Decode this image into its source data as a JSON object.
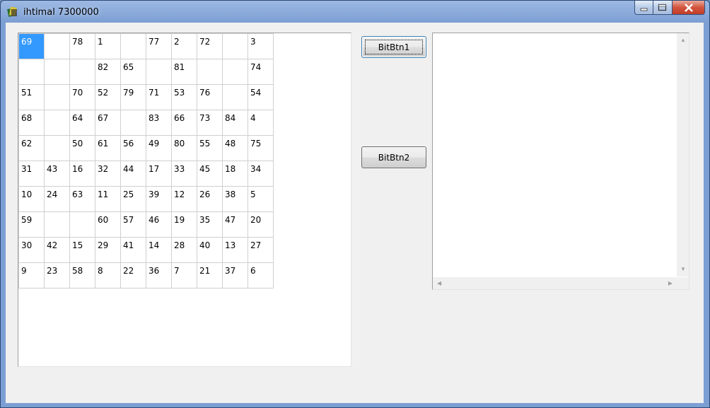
{
  "window": {
    "title": "ihtimal 7300000"
  },
  "grid": {
    "selected": {
      "row": 0,
      "col": 0
    },
    "rows": [
      [
        "69",
        "",
        "78",
        "1",
        "",
        "77",
        "2",
        "72",
        "",
        "3"
      ],
      [
        "",
        "",
        "",
        "82",
        "65",
        "",
        "81",
        "",
        "",
        "74"
      ],
      [
        "51",
        "",
        "70",
        "52",
        "79",
        "71",
        "53",
        "76",
        "",
        "54"
      ],
      [
        "68",
        "",
        "64",
        "67",
        "",
        "83",
        "66",
        "73",
        "84",
        "4"
      ],
      [
        "62",
        "",
        "50",
        "61",
        "56",
        "49",
        "80",
        "55",
        "48",
        "75"
      ],
      [
        "31",
        "43",
        "16",
        "32",
        "44",
        "17",
        "33",
        "45",
        "18",
        "34"
      ],
      [
        "10",
        "24",
        "63",
        "11",
        "25",
        "39",
        "12",
        "26",
        "38",
        "5"
      ],
      [
        "59",
        "",
        "",
        "60",
        "57",
        "46",
        "19",
        "35",
        "47",
        "20"
      ],
      [
        "30",
        "42",
        "15",
        "29",
        "41",
        "14",
        "28",
        "40",
        "13",
        "27"
      ],
      [
        "9",
        "23",
        "58",
        "8",
        "22",
        "36",
        "7",
        "21",
        "37",
        "6"
      ]
    ]
  },
  "buttons": {
    "btn1": "BitBtn1",
    "btn2": "BitBtn2"
  },
  "memo": {
    "text": ""
  }
}
